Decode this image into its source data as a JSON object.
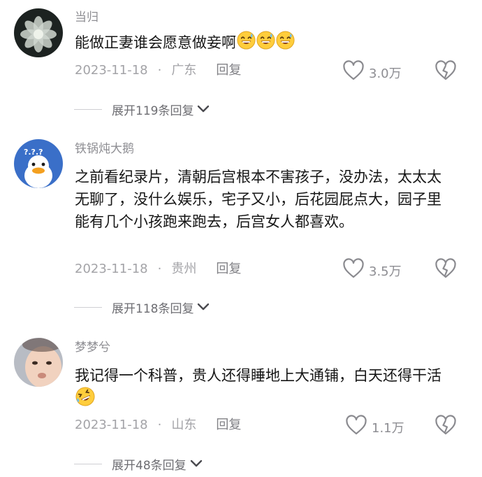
{
  "comments": [
    {
      "username": "当归",
      "text": "能做正妻谁会愿意做妾啊",
      "emojis": [
        "grinning-sweat-emoji",
        "grinning-sweat-emoji",
        "grinning-sweat-emoji"
      ],
      "date": "2023-11-18",
      "location": "广东",
      "reply_label": "回复",
      "likes": "3.0万",
      "expand_label": "展开119条回复"
    },
    {
      "username": "铁锅炖大鹅",
      "text": "之前看纪录片，清朝后宫根本不害孩子，没办法，太太太无聊了，没什么娱乐，宅子又小，后花园屁点大，园子里能有几个小孩跑来跑去，后宫女人都喜欢。",
      "date": "2023-11-18",
      "location": "贵州",
      "reply_label": "回复",
      "likes": "3.5万",
      "expand_label": "展开118条回复"
    },
    {
      "username": "梦梦兮",
      "text": "我记得一个科普，贵人还得睡地上大通铺，白天还得干活",
      "emojis": [
        "rolling-laughing-emoji"
      ],
      "date": "2023-11-18",
      "location": "山东",
      "reply_label": "回复",
      "likes": "1.1万",
      "expand_label": "展开48条回复"
    }
  ],
  "colors": {
    "text": "#161616",
    "muted": "#a3a3a7",
    "username": "#8e8e93",
    "emoji_yellow": "#ffcd3c"
  }
}
